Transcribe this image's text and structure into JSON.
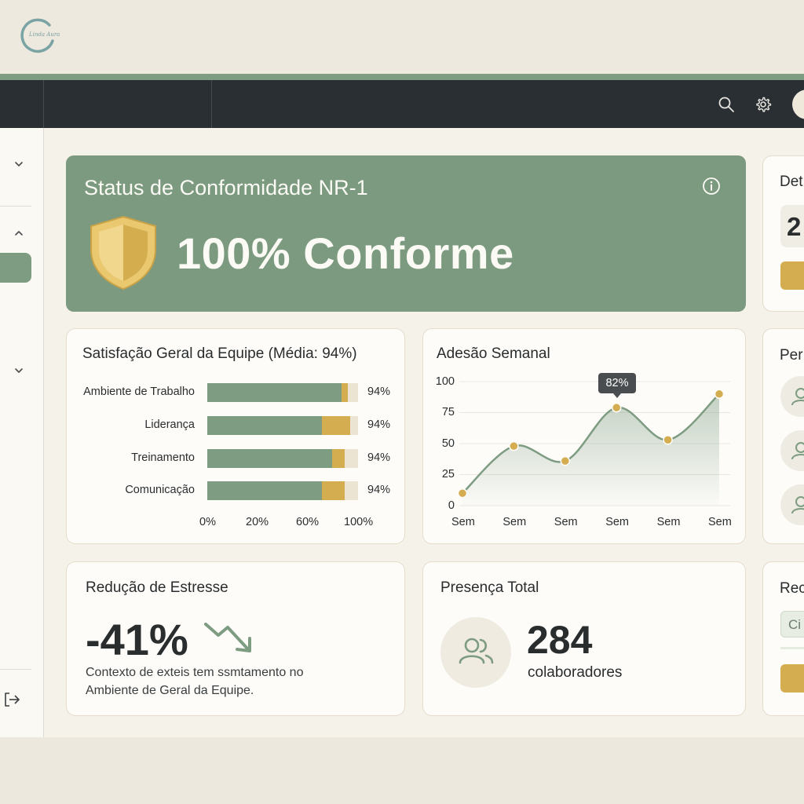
{
  "brand": {
    "logo_text": "Linda Aura"
  },
  "hero": {
    "title": "Status de Conformidade NR-1",
    "value": "100% Conforme"
  },
  "satisfaction": {
    "title": "Satisfação Geral da Equipe (Média: 94%)",
    "rows": [
      {
        "label": "Ambiente de Trabalho",
        "pct_text": "94%",
        "green": 0.89,
        "gold": 0.04
      },
      {
        "label": "Liderança",
        "pct_text": "94%",
        "green": 0.76,
        "gold": 0.19
      },
      {
        "label": "Treinamento",
        "pct_text": "94%",
        "green": 0.83,
        "gold": 0.08
      },
      {
        "label": "Comunicação",
        "pct_text": "94%",
        "green": 0.76,
        "gold": 0.15
      }
    ],
    "x_ticks": [
      "0%",
      "20%",
      "60%",
      "100%"
    ]
  },
  "adhesion": {
    "title": "Adesão Semanal",
    "tooltip": "82%",
    "y_ticks": [
      "100",
      "75",
      "50",
      "25",
      "0"
    ]
  },
  "chart_data": {
    "type": "area",
    "title": "Adesão Semanal",
    "categories": [
      "Sem",
      "Sem",
      "Sem",
      "Sem",
      "Sem",
      "Sem"
    ],
    "values": [
      10,
      48,
      36,
      79,
      53,
      90
    ],
    "ylim": [
      0,
      100
    ],
    "y_ticks": [
      0,
      25,
      50,
      75,
      100
    ],
    "annotation": "82%",
    "grid": true,
    "colors": {
      "line": "#7e9c82",
      "point": "#d3ad50"
    }
  },
  "stress": {
    "title": "Redução de Estresse",
    "value": "-41%",
    "desc_line1": "Contexto de exteis tem ssmtamento no",
    "desc_line2": "Ambiente de Geral da Equipe."
  },
  "presence": {
    "title": "Presença Total",
    "value": "284",
    "unit": "colaboradores"
  },
  "right_col": {
    "card1_title": "Det",
    "card1_value": "2",
    "card2_title": "Per",
    "card3_title": "Rec",
    "card3_chip": "Ci"
  },
  "icons": {
    "search": "search-icon",
    "settings": "gear-icon",
    "info": "info-icon",
    "shield": "shield-icon",
    "trend": "trending-down-icon",
    "people": "users-icon",
    "logout": "logout-icon"
  },
  "colors": {
    "primary": "#7b9a7f",
    "accent": "#d3ad50",
    "nav": "#2a2f34",
    "bg": "#f5f2ea"
  }
}
